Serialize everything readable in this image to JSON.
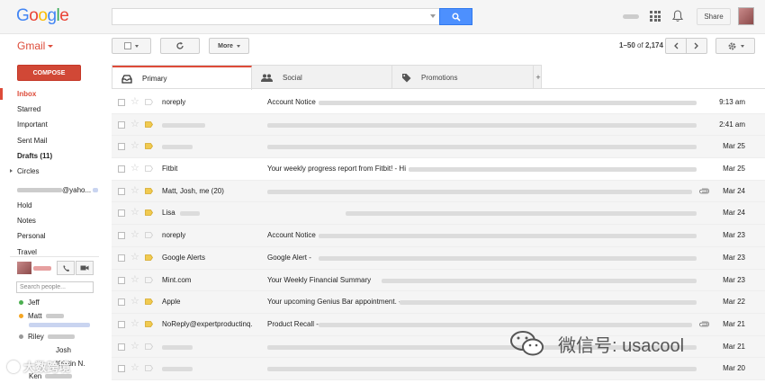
{
  "header": {
    "logo_text": "Google",
    "logo_colors": [
      "#4285f4",
      "#ea4335",
      "#fbbc05",
      "#4285f4",
      "#34a853",
      "#ea4335"
    ],
    "search_placeholder": "",
    "share_label": "Share"
  },
  "toolbar": {
    "app_label": "Gmail",
    "more_label": "More",
    "pager_range": "1–50",
    "pager_of": "of",
    "pager_total": "2,174"
  },
  "sidebar": {
    "compose_label": "COMPOSE",
    "items": [
      {
        "label": "Inbox",
        "active": true
      },
      {
        "label": "Starred"
      },
      {
        "label": "Important"
      },
      {
        "label": "Sent Mail"
      },
      {
        "label": "Drafts (11)",
        "bold": true
      },
      {
        "label": "Circles",
        "expandable": true
      }
    ],
    "account_suffix": "@yaho...",
    "labels": [
      "Hold",
      "Notes",
      "Personal",
      "Travel"
    ]
  },
  "hangouts": {
    "search_placeholder": "Search people...",
    "contacts": [
      {
        "name": "Jeff",
        "status_color": "#4caf50"
      },
      {
        "name": "Matt",
        "status_color": "#f5a623"
      },
      {
        "name": "Riley",
        "status_color": "#999999"
      },
      {
        "name": "Josh"
      },
      {
        "name": "Kristin N."
      },
      {
        "name": "Ken"
      }
    ]
  },
  "tabs": [
    {
      "label": "Primary",
      "icon": "inbox-icon",
      "active": true
    },
    {
      "label": "Social",
      "icon": "people-icon"
    },
    {
      "label": "Promotions",
      "icon": "tag-icon"
    }
  ],
  "tab_add_label": "+",
  "emails": [
    {
      "sender": "noreply",
      "subject": "Account Notice",
      "date": "9:13 am",
      "unread": true,
      "important": false
    },
    {
      "sender": "",
      "subject": "",
      "date": "2:41 am",
      "unread": false,
      "important": true
    },
    {
      "sender": "",
      "subject": "",
      "date": "Mar 25",
      "unread": false,
      "important": true
    },
    {
      "sender": "Fitbit",
      "subject": "Your weekly progress report from Fitbit! - Hi",
      "date": "Mar 25",
      "unread": true,
      "important": false
    },
    {
      "sender": "Matt, Josh, me (20)",
      "subject": "",
      "date": "Mar 24",
      "unread": false,
      "important": true,
      "attachment": true
    },
    {
      "sender": "Lisa",
      "subject": "",
      "date": "Mar 24",
      "unread": false,
      "important": true
    },
    {
      "sender": "noreply",
      "subject": "Account Notice",
      "date": "Mar 23",
      "unread": false,
      "important": false
    },
    {
      "sender": "Google Alerts",
      "subject": "Google Alert -",
      "date": "Mar 23",
      "unread": false,
      "important": true
    },
    {
      "sender": "Mint.com",
      "subject": "Your Weekly Financial Summary",
      "date": "Mar 23",
      "unread": false,
      "important": false
    },
    {
      "sender": "Apple",
      "subject": "Your upcoming Genius Bar appointment. -",
      "date": "Mar 22",
      "unread": false,
      "important": true
    },
    {
      "sender": "NoReply@expertproductinq.",
      "subject": "Product Recall -",
      "date": "Mar 21",
      "unread": false,
      "important": true,
      "attachment": true
    },
    {
      "sender": "",
      "subject": "",
      "date": "Mar 21",
      "unread": false,
      "important": false
    },
    {
      "sender": "",
      "subject": "",
      "date": "Mar 20",
      "unread": false,
      "important": false
    }
  ],
  "watermark": {
    "left_text": "大数跨境",
    "right_text": "微信号: usacool"
  },
  "colors": {
    "accent_red": "#dd4b39",
    "compose_red": "#d14836",
    "search_blue": "#4d90fe",
    "important_yellow": "#f1ca50"
  }
}
